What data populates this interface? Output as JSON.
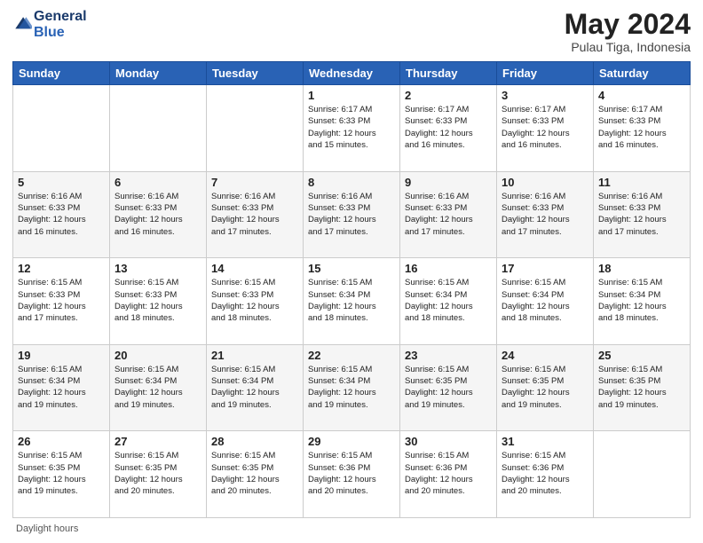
{
  "logo": {
    "text_general": "General",
    "text_blue": "Blue"
  },
  "header": {
    "month_year": "May 2024",
    "location": "Pulau Tiga, Indonesia"
  },
  "footer": {
    "label": "Daylight hours"
  },
  "weekdays": [
    "Sunday",
    "Monday",
    "Tuesday",
    "Wednesday",
    "Thursday",
    "Friday",
    "Saturday"
  ],
  "weeks": [
    {
      "days": [
        {
          "num": "",
          "info": ""
        },
        {
          "num": "",
          "info": ""
        },
        {
          "num": "",
          "info": ""
        },
        {
          "num": "1",
          "info": "Sunrise: 6:17 AM\nSunset: 6:33 PM\nDaylight: 12 hours\nand 15 minutes."
        },
        {
          "num": "2",
          "info": "Sunrise: 6:17 AM\nSunset: 6:33 PM\nDaylight: 12 hours\nand 16 minutes."
        },
        {
          "num": "3",
          "info": "Sunrise: 6:17 AM\nSunset: 6:33 PM\nDaylight: 12 hours\nand 16 minutes."
        },
        {
          "num": "4",
          "info": "Sunrise: 6:17 AM\nSunset: 6:33 PM\nDaylight: 12 hours\nand 16 minutes."
        }
      ]
    },
    {
      "days": [
        {
          "num": "5",
          "info": "Sunrise: 6:16 AM\nSunset: 6:33 PM\nDaylight: 12 hours\nand 16 minutes."
        },
        {
          "num": "6",
          "info": "Sunrise: 6:16 AM\nSunset: 6:33 PM\nDaylight: 12 hours\nand 16 minutes."
        },
        {
          "num": "7",
          "info": "Sunrise: 6:16 AM\nSunset: 6:33 PM\nDaylight: 12 hours\nand 17 minutes."
        },
        {
          "num": "8",
          "info": "Sunrise: 6:16 AM\nSunset: 6:33 PM\nDaylight: 12 hours\nand 17 minutes."
        },
        {
          "num": "9",
          "info": "Sunrise: 6:16 AM\nSunset: 6:33 PM\nDaylight: 12 hours\nand 17 minutes."
        },
        {
          "num": "10",
          "info": "Sunrise: 6:16 AM\nSunset: 6:33 PM\nDaylight: 12 hours\nand 17 minutes."
        },
        {
          "num": "11",
          "info": "Sunrise: 6:16 AM\nSunset: 6:33 PM\nDaylight: 12 hours\nand 17 minutes."
        }
      ]
    },
    {
      "days": [
        {
          "num": "12",
          "info": "Sunrise: 6:15 AM\nSunset: 6:33 PM\nDaylight: 12 hours\nand 17 minutes."
        },
        {
          "num": "13",
          "info": "Sunrise: 6:15 AM\nSunset: 6:33 PM\nDaylight: 12 hours\nand 18 minutes."
        },
        {
          "num": "14",
          "info": "Sunrise: 6:15 AM\nSunset: 6:33 PM\nDaylight: 12 hours\nand 18 minutes."
        },
        {
          "num": "15",
          "info": "Sunrise: 6:15 AM\nSunset: 6:34 PM\nDaylight: 12 hours\nand 18 minutes."
        },
        {
          "num": "16",
          "info": "Sunrise: 6:15 AM\nSunset: 6:34 PM\nDaylight: 12 hours\nand 18 minutes."
        },
        {
          "num": "17",
          "info": "Sunrise: 6:15 AM\nSunset: 6:34 PM\nDaylight: 12 hours\nand 18 minutes."
        },
        {
          "num": "18",
          "info": "Sunrise: 6:15 AM\nSunset: 6:34 PM\nDaylight: 12 hours\nand 18 minutes."
        }
      ]
    },
    {
      "days": [
        {
          "num": "19",
          "info": "Sunrise: 6:15 AM\nSunset: 6:34 PM\nDaylight: 12 hours\nand 19 minutes."
        },
        {
          "num": "20",
          "info": "Sunrise: 6:15 AM\nSunset: 6:34 PM\nDaylight: 12 hours\nand 19 minutes."
        },
        {
          "num": "21",
          "info": "Sunrise: 6:15 AM\nSunset: 6:34 PM\nDaylight: 12 hours\nand 19 minutes."
        },
        {
          "num": "22",
          "info": "Sunrise: 6:15 AM\nSunset: 6:34 PM\nDaylight: 12 hours\nand 19 minutes."
        },
        {
          "num": "23",
          "info": "Sunrise: 6:15 AM\nSunset: 6:35 PM\nDaylight: 12 hours\nand 19 minutes."
        },
        {
          "num": "24",
          "info": "Sunrise: 6:15 AM\nSunset: 6:35 PM\nDaylight: 12 hours\nand 19 minutes."
        },
        {
          "num": "25",
          "info": "Sunrise: 6:15 AM\nSunset: 6:35 PM\nDaylight: 12 hours\nand 19 minutes."
        }
      ]
    },
    {
      "days": [
        {
          "num": "26",
          "info": "Sunrise: 6:15 AM\nSunset: 6:35 PM\nDaylight: 12 hours\nand 19 minutes."
        },
        {
          "num": "27",
          "info": "Sunrise: 6:15 AM\nSunset: 6:35 PM\nDaylight: 12 hours\nand 20 minutes."
        },
        {
          "num": "28",
          "info": "Sunrise: 6:15 AM\nSunset: 6:35 PM\nDaylight: 12 hours\nand 20 minutes."
        },
        {
          "num": "29",
          "info": "Sunrise: 6:15 AM\nSunset: 6:36 PM\nDaylight: 12 hours\nand 20 minutes."
        },
        {
          "num": "30",
          "info": "Sunrise: 6:15 AM\nSunset: 6:36 PM\nDaylight: 12 hours\nand 20 minutes."
        },
        {
          "num": "31",
          "info": "Sunrise: 6:15 AM\nSunset: 6:36 PM\nDaylight: 12 hours\nand 20 minutes."
        },
        {
          "num": "",
          "info": ""
        }
      ]
    }
  ]
}
